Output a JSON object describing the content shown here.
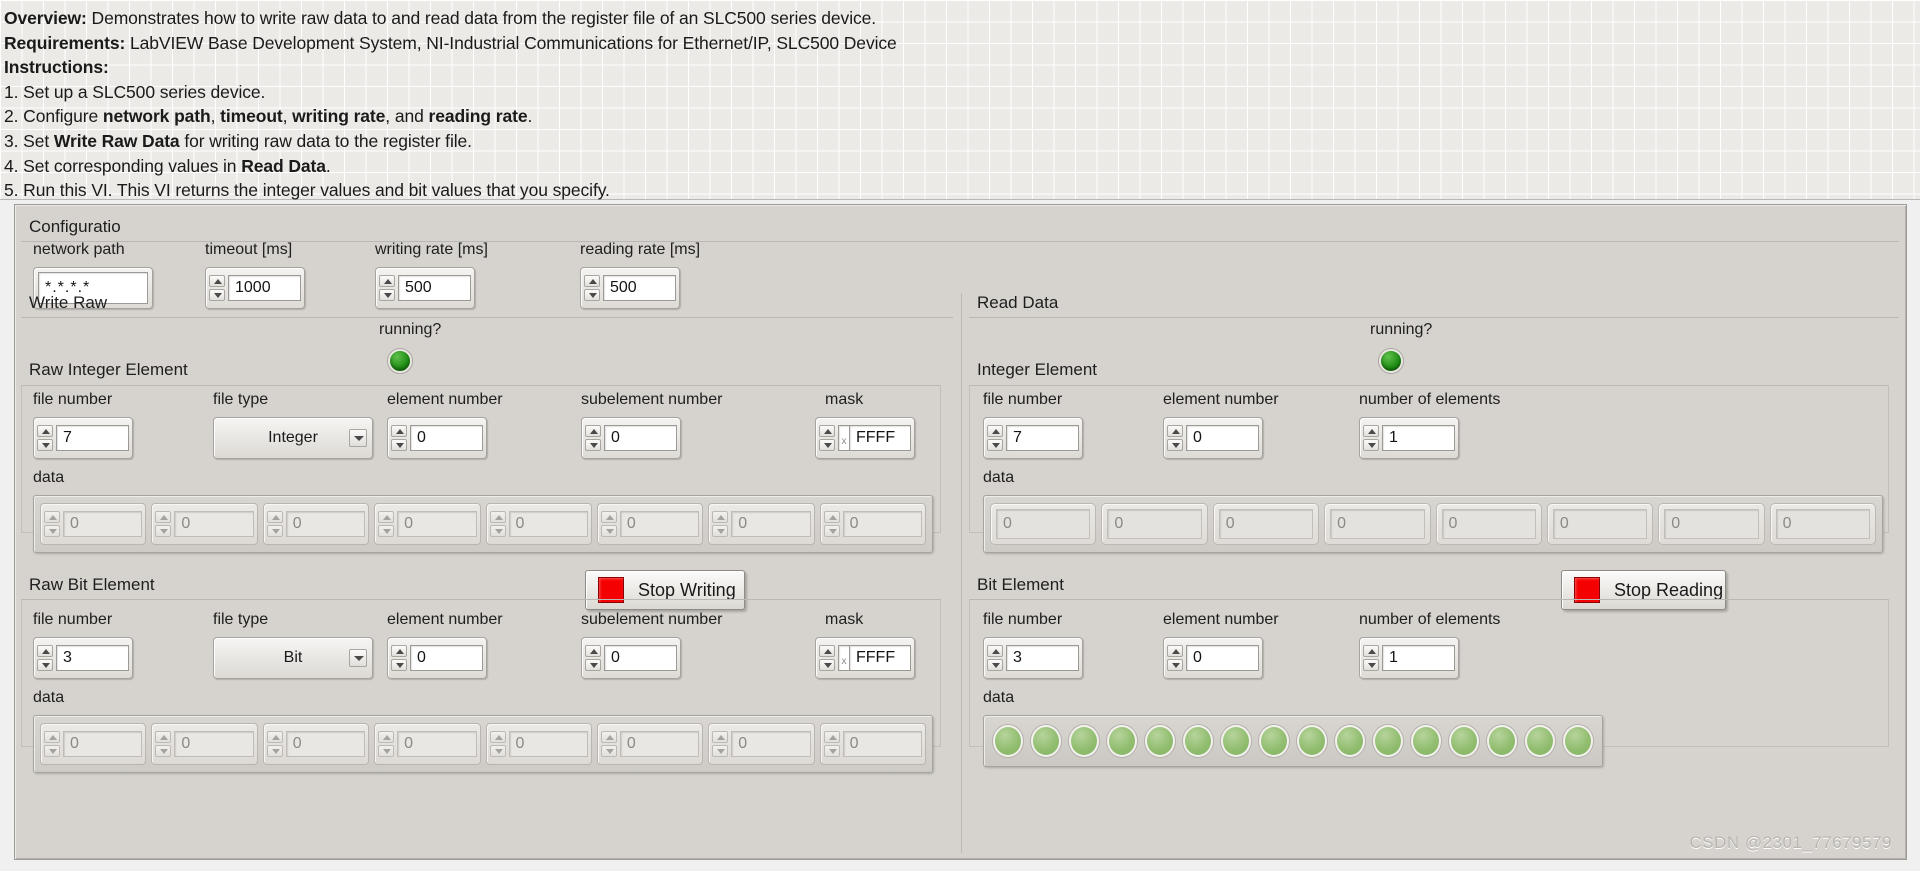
{
  "doc": {
    "lines": [
      {
        "bold": "Overview:",
        "rest": " Demonstrates how to write raw data to and read data from the register file of an SLC500 series device."
      },
      {
        "bold": "Requirements:",
        "rest": " LabVIEW Base Development System, NI-Industrial Communications for Ethernet/IP, SLC500 Device"
      },
      {
        "bold": "Instructions:",
        "rest": ""
      },
      {
        "bold": "",
        "rest": "1. Set up a SLC500 series device."
      },
      {
        "bold": "",
        "rest": "2. Configure network path, timeout, writing rate, and reading rate."
      },
      {
        "bold": "",
        "rest": "3. Set Write Raw Data for writing raw data to the register file."
      },
      {
        "bold": "",
        "rest": "4. Set corresponding values in Read Data."
      },
      {
        "bold": "",
        "rest": "5. Run this VI. This VI returns the integer values and bit values that you specify."
      }
    ]
  },
  "configuration": {
    "title": "Configuratio",
    "network_path": {
      "label": "network path",
      "value": "*.*.*.*"
    },
    "timeout": {
      "label": "timeout [ms]",
      "value": "1000"
    },
    "writing_rate": {
      "label": "writing rate [ms]",
      "value": "500"
    },
    "reading_rate": {
      "label": "reading rate [ms]",
      "value": "500"
    }
  },
  "write": {
    "title": "Write Raw",
    "running_label": "running?",
    "stop_button": "Stop Writing",
    "integer": {
      "title": "Raw Integer Element",
      "file_number": {
        "label": "file number",
        "value": "7"
      },
      "file_type": {
        "label": "file type",
        "value": "Integer"
      },
      "element_number": {
        "label": "element number",
        "value": "0"
      },
      "subelement_number": {
        "label": "subelement number",
        "value": "0"
      },
      "mask": {
        "label": "mask",
        "radix": "x",
        "value": "FFFF"
      },
      "data_label": "data",
      "data": [
        "0",
        "0",
        "0",
        "0",
        "0",
        "0",
        "0",
        "0"
      ]
    },
    "bit": {
      "title": "Raw Bit Element",
      "file_number": {
        "label": "file number",
        "value": "3"
      },
      "file_type": {
        "label": "file type",
        "value": "Bit"
      },
      "element_number": {
        "label": "element number",
        "value": "0"
      },
      "subelement_number": {
        "label": "subelement number",
        "value": "0"
      },
      "mask": {
        "label": "mask",
        "radix": "x",
        "value": "FFFF"
      },
      "data_label": "data",
      "data": [
        "0",
        "0",
        "0",
        "0",
        "0",
        "0",
        "0",
        "0"
      ]
    }
  },
  "read": {
    "title": "Read Data",
    "running_label": "running?",
    "stop_button": "Stop Reading",
    "integer": {
      "title": "Integer Element",
      "file_number": {
        "label": "file number",
        "value": "7"
      },
      "element_number": {
        "label": "element number",
        "value": "0"
      },
      "number_of_elements": {
        "label": "number of elements",
        "value": "1"
      },
      "data_label": "data",
      "data": [
        "0",
        "0",
        "0",
        "0",
        "0",
        "0",
        "0",
        "0"
      ]
    },
    "bit": {
      "title": "Bit Element",
      "file_number": {
        "label": "file number",
        "value": "3"
      },
      "element_number": {
        "label": "element number",
        "value": "0"
      },
      "number_of_elements": {
        "label": "number of elements",
        "value": "1"
      },
      "data_label": "data",
      "leds": [
        false,
        false,
        false,
        false,
        false,
        false,
        false,
        false,
        false,
        false,
        false,
        false,
        false,
        false,
        false,
        false
      ]
    }
  },
  "watermark": "CSDN @2301_77679579",
  "colors": {
    "panel": "#d6d3ce",
    "stop_red": "#f40000",
    "led_on": "#1c8b12",
    "led_off": "#8fbc6d"
  }
}
